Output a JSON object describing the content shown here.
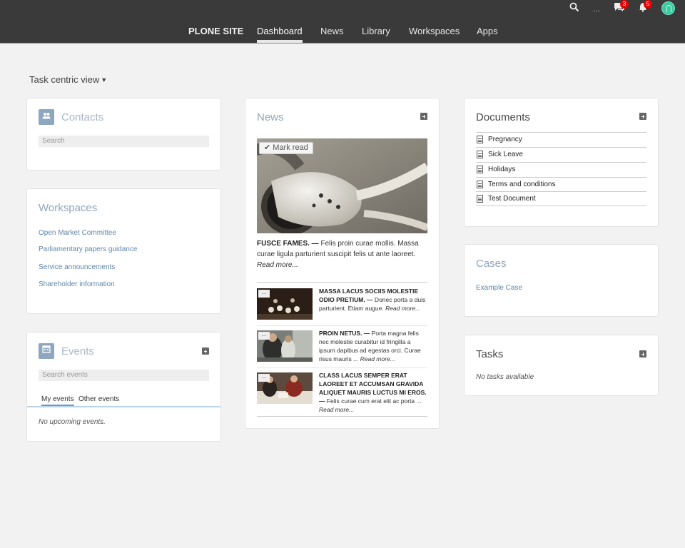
{
  "nav": {
    "brand": "PLONE SITE",
    "items": [
      "Dashboard",
      "News",
      "Library",
      "Workspaces",
      "Apps"
    ]
  },
  "toolbar": {
    "more": "...",
    "messages_count": "3",
    "notifications_count": "5"
  },
  "view_toggle": "Task centric view",
  "contacts": {
    "title": "Contacts",
    "search_placeholder": "Search"
  },
  "workspaces": {
    "title": "Workspaces",
    "items": [
      "Open Market Committee",
      "Parliamentary papers guidance",
      "Service announcements",
      "Shareholder information"
    ]
  },
  "events": {
    "title": "Events",
    "search_placeholder": "Search events",
    "tabs": [
      "My events",
      "Other events"
    ],
    "empty": "No upcoming events."
  },
  "news": {
    "title": "News",
    "mark_read": "Mark read",
    "lead": {
      "headline": "FUSCE FAMES. —",
      "body": " Felis proin curae mollis. Massa curae ligula parturient suscipit felis ut ante laoreet. ",
      "more": "Read more..."
    },
    "items": [
      {
        "headline": "MASSA LACUS SOCIIS MOLESTIE ODIO PRETIUM. —",
        "body": " Donec porta a duis parturient. Etiam augue. ",
        "more": "Read more..."
      },
      {
        "headline": "PROIN NETUS. —",
        "body": " Porta magna felis nec molestie curabitur id fringilla a ipsum dapibus ad egestas orci. Curae risus mauris ... ",
        "more": "Read more..."
      },
      {
        "headline": "CLASS LACUS SEMPER ERAT LAOREET ET ACCUMSAN GRAVIDA ALIQUET MAURIS LUCTUS MI EROS. —",
        "body": " Felis curae cum erat elit ac porta ... ",
        "more": "Read more..."
      }
    ],
    "thumb_more": "..."
  },
  "documents": {
    "title": "Documents",
    "items": [
      "Pregnancy",
      "Sick Leave",
      "Holidays",
      "Terms and conditions",
      "Test Document"
    ]
  },
  "cases": {
    "title": "Cases",
    "items": [
      "Example Case"
    ]
  },
  "tasks": {
    "title": "Tasks",
    "empty": "No tasks available"
  }
}
